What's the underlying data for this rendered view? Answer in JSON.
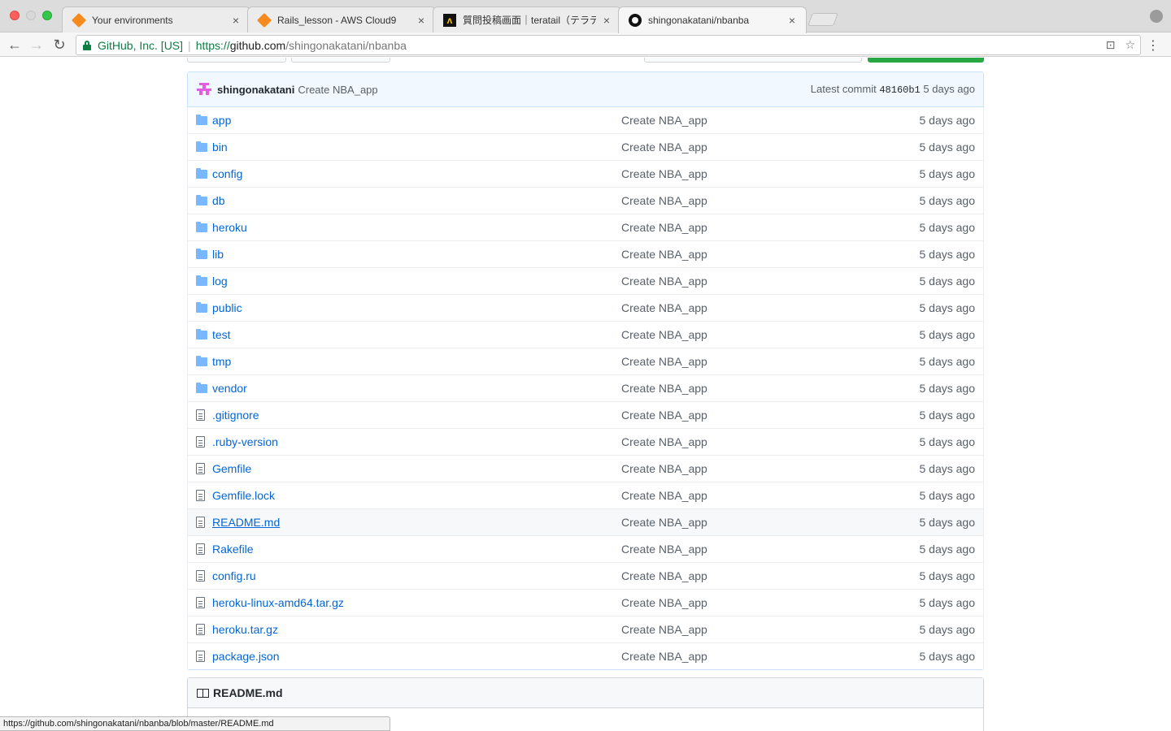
{
  "browser": {
    "tabs": [
      {
        "title": "Your environments",
        "icon": "aws-cloud9-icon"
      },
      {
        "title": "Rails_lesson - AWS Cloud9",
        "icon": "aws-cloud9-icon"
      },
      {
        "title": "質問投稿画面｜teratail（テラテイ",
        "icon": "teratail-icon"
      },
      {
        "title": "shingonakatani/nbanba",
        "icon": "github-icon"
      }
    ],
    "tab_close": "×",
    "address": {
      "ev_label": "GitHub, Inc. [US]",
      "separator": "|",
      "scheme": "https://",
      "host": "github.com",
      "path": "/shingonakatani/nbanba"
    },
    "status_url": "https://github.com/shingonakatani/nbanba/blob/master/README.md"
  },
  "commit": {
    "author": "shingonakatani",
    "message": "Create NBA_app",
    "latest_label": "Latest commit",
    "sha": "48160b1",
    "age": "5 days ago"
  },
  "files": [
    {
      "type": "dir",
      "name": "app",
      "message": "Create NBA_app",
      "age": "5 days ago"
    },
    {
      "type": "dir",
      "name": "bin",
      "message": "Create NBA_app",
      "age": "5 days ago"
    },
    {
      "type": "dir",
      "name": "config",
      "message": "Create NBA_app",
      "age": "5 days ago"
    },
    {
      "type": "dir",
      "name": "db",
      "message": "Create NBA_app",
      "age": "5 days ago"
    },
    {
      "type": "dir",
      "name": "heroku",
      "message": "Create NBA_app",
      "age": "5 days ago"
    },
    {
      "type": "dir",
      "name": "lib",
      "message": "Create NBA_app",
      "age": "5 days ago"
    },
    {
      "type": "dir",
      "name": "log",
      "message": "Create NBA_app",
      "age": "5 days ago"
    },
    {
      "type": "dir",
      "name": "public",
      "message": "Create NBA_app",
      "age": "5 days ago"
    },
    {
      "type": "dir",
      "name": "test",
      "message": "Create NBA_app",
      "age": "5 days ago"
    },
    {
      "type": "dir",
      "name": "tmp",
      "message": "Create NBA_app",
      "age": "5 days ago"
    },
    {
      "type": "dir",
      "name": "vendor",
      "message": "Create NBA_app",
      "age": "5 days ago"
    },
    {
      "type": "file",
      "name": ".gitignore",
      "message": "Create NBA_app",
      "age": "5 days ago"
    },
    {
      "type": "file",
      "name": ".ruby-version",
      "message": "Create NBA_app",
      "age": "5 days ago"
    },
    {
      "type": "file",
      "name": "Gemfile",
      "message": "Create NBA_app",
      "age": "5 days ago"
    },
    {
      "type": "file",
      "name": "Gemfile.lock",
      "message": "Create NBA_app",
      "age": "5 days ago"
    },
    {
      "type": "file",
      "name": "README.md",
      "message": "Create NBA_app",
      "age": "5 days ago",
      "hover": true
    },
    {
      "type": "file",
      "name": "Rakefile",
      "message": "Create NBA_app",
      "age": "5 days ago"
    },
    {
      "type": "file",
      "name": "config.ru",
      "message": "Create NBA_app",
      "age": "5 days ago"
    },
    {
      "type": "file",
      "name": "heroku-linux-amd64.tar.gz",
      "message": "Create NBA_app",
      "age": "5 days ago"
    },
    {
      "type": "file",
      "name": "heroku.tar.gz",
      "message": "Create NBA_app",
      "age": "5 days ago"
    },
    {
      "type": "file",
      "name": "package.json",
      "message": "Create NBA_app",
      "age": "5 days ago"
    }
  ],
  "readme": {
    "title": "README.md"
  },
  "colors": {
    "link": "#0366d6",
    "commit_bar": "#f1f8ff",
    "green_button": "#28a745"
  }
}
